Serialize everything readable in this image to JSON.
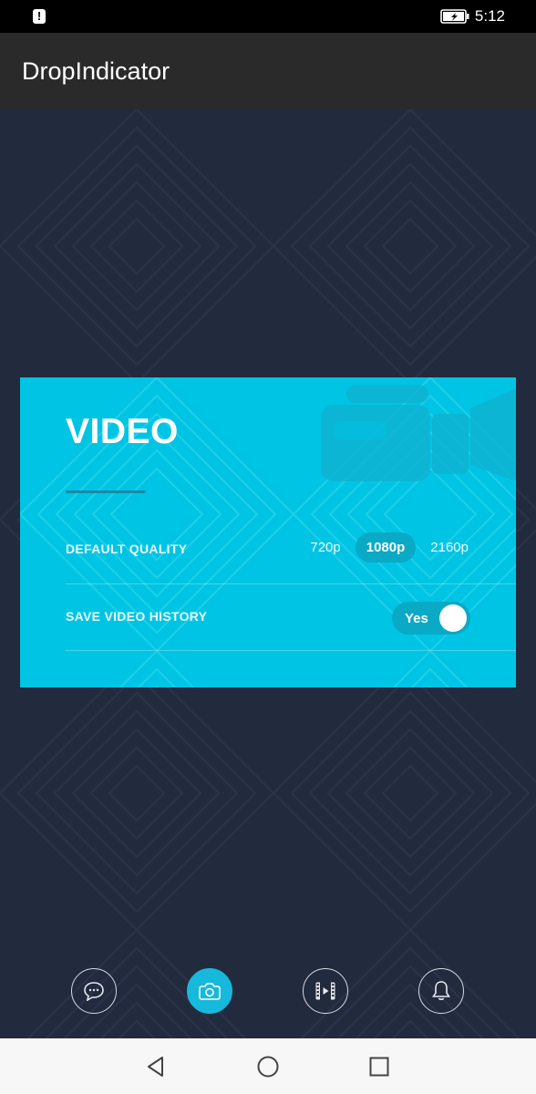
{
  "status_bar": {
    "time": "5:12",
    "icons": [
      "alert-icon",
      "battery-charging-icon"
    ]
  },
  "app_bar": {
    "title": "DropIndicator"
  },
  "card": {
    "title": "VIDEO",
    "background_color": "#00c4e4",
    "watermark_icon": "video-camera-icon",
    "settings": {
      "quality": {
        "label": "DEFAULT QUALITY",
        "options": [
          "720p",
          "1080p",
          "2160p"
        ],
        "selected": "1080p"
      },
      "history": {
        "label": "SAVE VIDEO HISTORY",
        "toggle_text": "Yes",
        "toggle_on": true
      }
    }
  },
  "bottom_nav": {
    "items": [
      {
        "icon": "chat-bubble-icon",
        "active": false
      },
      {
        "icon": "camera-icon",
        "active": true
      },
      {
        "icon": "film-icon",
        "active": false
      },
      {
        "icon": "bell-icon",
        "active": false
      }
    ],
    "active_color": "#16b9dc"
  },
  "system_nav": {
    "icons": [
      "back-icon",
      "home-icon",
      "recents-icon"
    ]
  }
}
